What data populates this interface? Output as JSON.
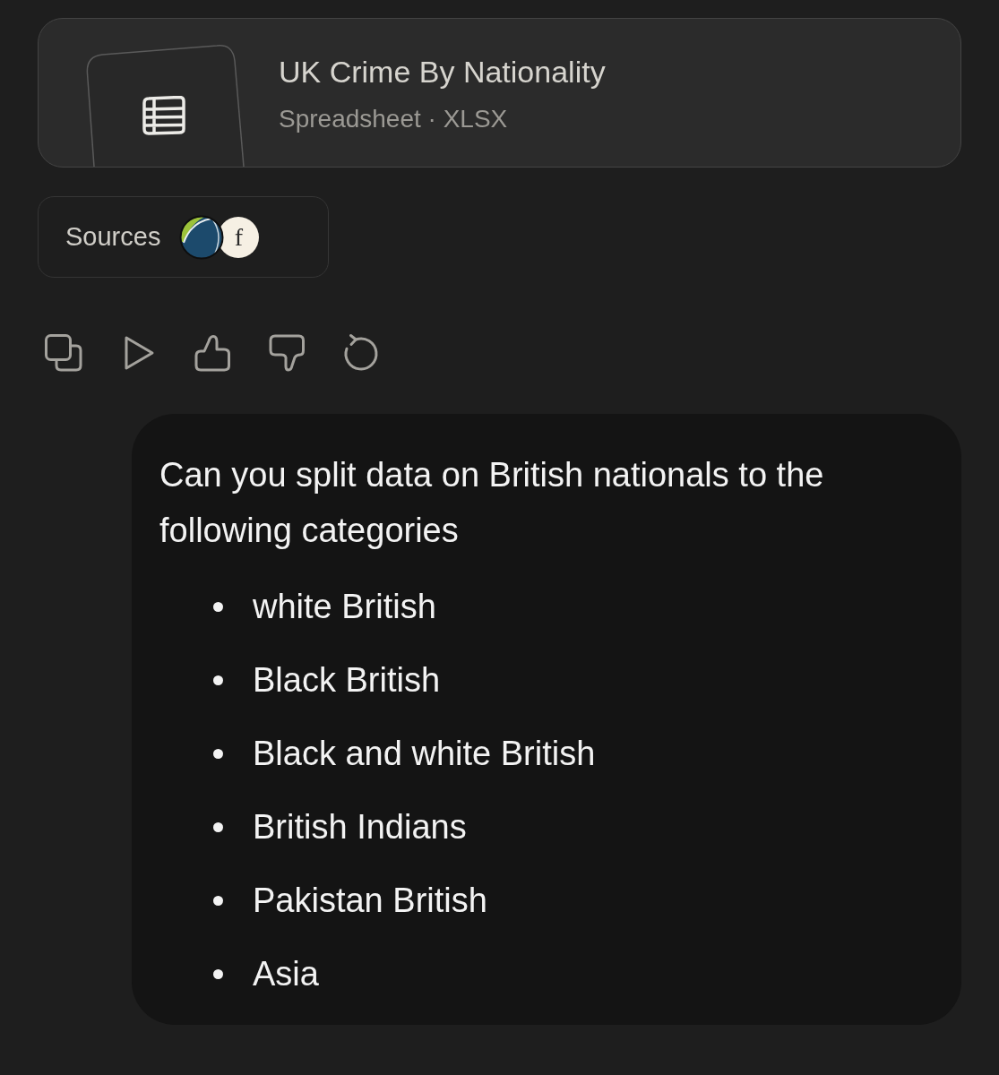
{
  "attachment": {
    "title": "UK Crime By Nationality",
    "subtitle": "Spreadsheet · XLSX"
  },
  "sources": {
    "label": "Sources",
    "logos": [
      {
        "kind": "globe"
      },
      {
        "kind": "letter",
        "letter": "f"
      }
    ]
  },
  "message": {
    "text": "Can you split data on British nationals to the following categories",
    "items": [
      "white British",
      "Black British",
      "Black and white British",
      "British Indians",
      "Pakistan British",
      "Asia"
    ]
  }
}
